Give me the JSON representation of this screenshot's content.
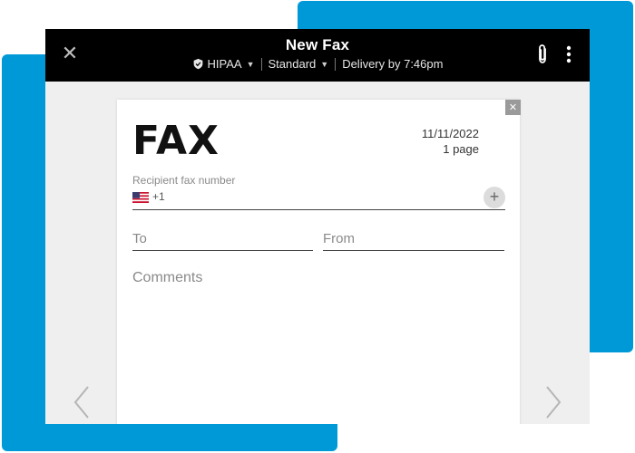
{
  "header": {
    "title": "New Fax",
    "hipaa_label": "HIPAA",
    "quality_label": "Standard",
    "delivery_label": "Delivery by 7:46pm"
  },
  "fax": {
    "heading": "FAX",
    "date": "11/11/2022",
    "pages": "1 page",
    "recipient_label": "Recipient fax number",
    "country_code": "+1",
    "to_placeholder": "To",
    "from_placeholder": "From",
    "comments_placeholder": "Comments"
  },
  "icons": [
    "close-icon",
    "shield-icon",
    "chevron-down-icon",
    "paperclip-icon",
    "more-vertical-icon",
    "us-flag-icon",
    "plus-icon",
    "chevron-left-icon",
    "chevron-right-icon"
  ],
  "colors": {
    "accent_blue": "#0099d8",
    "topbar": "#000000",
    "background": "#efefef"
  }
}
